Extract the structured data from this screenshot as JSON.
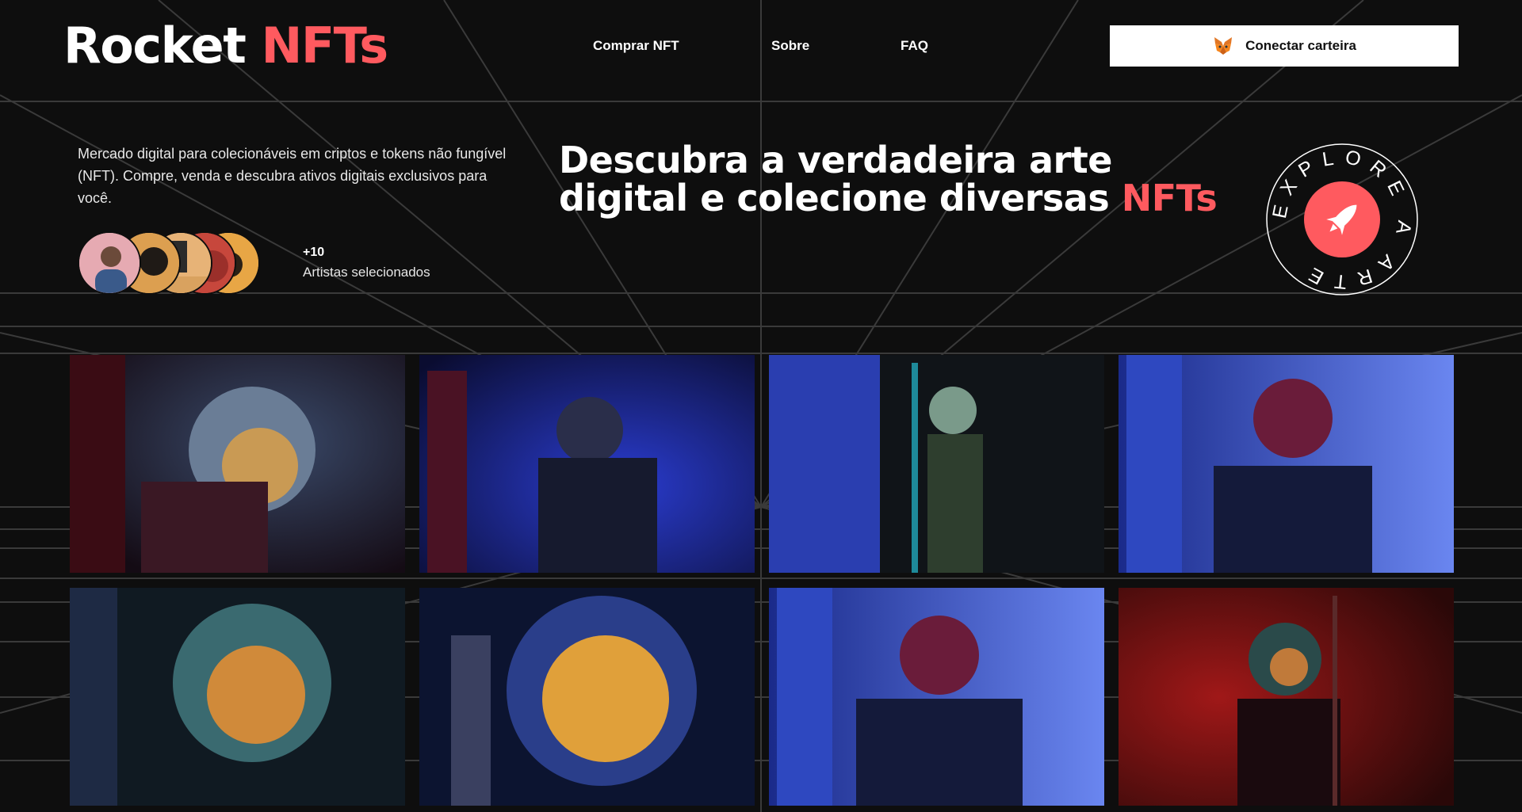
{
  "header": {
    "logo_primary": "Rocket",
    "logo_accent": "NFTs",
    "nav": [
      {
        "label": "Comprar NFT"
      },
      {
        "label": "Sobre"
      },
      {
        "label": "FAQ"
      }
    ],
    "wallet_button_label": "Conectar carteira",
    "wallet_icon": "metamask-fox-icon"
  },
  "hero": {
    "description": "Mercado digital para colecionáveis em criptos e tokens não fungível (NFT). Compre, venda e descubra ativos digitais exclusivos para você.",
    "artists_count": "+10",
    "artists_label": "Artistas selecionados",
    "headline_line1": "Descubra a verdadeira arte",
    "headline_line2_prefix": "digital e colecione diversas",
    "headline_accent": "NFTs",
    "badge_text": "EXPLORE A ARTE",
    "badge_icon": "rocket-icon"
  },
  "gallery": {
    "items": [
      {
        "icon": "astronaut-photo"
      },
      {
        "icon": "astronaut-photo"
      },
      {
        "icon": "astronaut-photo"
      },
      {
        "icon": "astronaut-photo"
      },
      {
        "icon": "astronaut-photo"
      },
      {
        "icon": "astronaut-photo"
      },
      {
        "icon": "astronaut-photo"
      },
      {
        "icon": "astronaut-photo"
      }
    ]
  },
  "colors": {
    "background": "#0e0e0e",
    "accent": "#ff5a5f",
    "text": "#ffffff",
    "button_bg": "#ffffff"
  }
}
